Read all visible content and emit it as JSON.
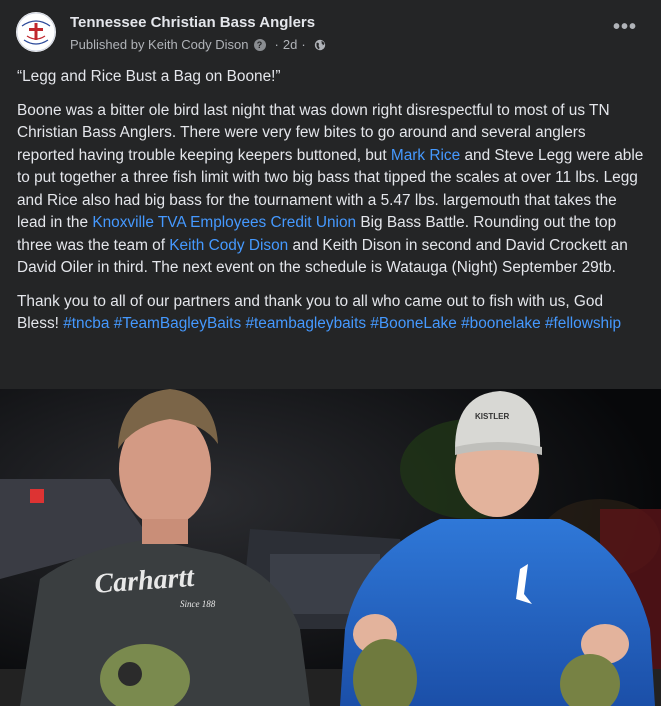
{
  "post": {
    "page_name": "Tennessee Christian Bass Anglers",
    "published_by": "Published by Keith Cody Dison",
    "question_mark": "?",
    "separator": "·",
    "time": "2d",
    "more_icon": "ellipsis-icon",
    "privacy_icon": "globe-icon",
    "logo_text_1": "Tennessee Christian",
    "logo_text_2": "Bass Anglers",
    "title": "“Legg and Rice Bust a Bag on Boone!”",
    "para1": [
      {
        "text": "Boone was a bitter ole bird last night that was down right disrespectful to most of us TN Christian Bass Anglers. There were very few bites to go around and several anglers reported having trouble keeping keepers buttoned, but "
      },
      {
        "text": "Mark Rice",
        "link": true
      },
      {
        "text": " and Steve Legg were able to put together a three fish limit with two big bass that tipped the scales at over 11 lbs. Legg and Rice also had big bass for the tournament with a 5.47 lbs. largemouth that takes the lead in the "
      },
      {
        "text": "Knoxville TVA Employees Credit Union",
        "link": true
      },
      {
        "text": " Big Bass Battle. Rounding out the top three was the team of "
      },
      {
        "text": "Keith Cody Dison",
        "link": true
      },
      {
        "text": " and Keith Dison in second and David Crockett an David Oiler in third. The next event on the schedule is Watauga (Night) September 29tb."
      }
    ],
    "para2": [
      {
        "text": "Thank you to all of our partners and thank you to all who came out to fish with us, God Bless! "
      },
      {
        "text": "#tncba",
        "link": true
      },
      {
        "text": " "
      },
      {
        "text": "#TeamBagleyBaits",
        "link": true
      },
      {
        "text": " "
      },
      {
        "text": "#teambagleybaits",
        "link": true
      },
      {
        "text": " "
      },
      {
        "text": "#BooneLake",
        "link": true
      },
      {
        "text": " "
      },
      {
        "text": "#boonelake",
        "link": true
      },
      {
        "text": " "
      },
      {
        "text": "#fellowship",
        "link": true
      }
    ],
    "photo": {
      "shirt_brand": "Carhartt",
      "shirt_sub": "Since 188",
      "cap_brand": "KISTLER"
    }
  }
}
